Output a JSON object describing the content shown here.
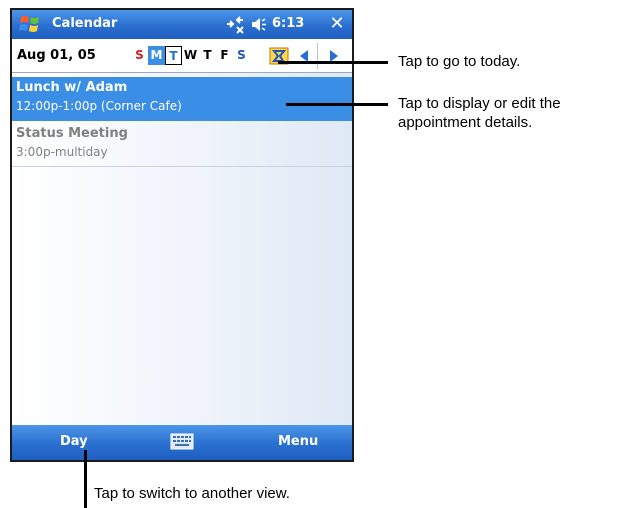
{
  "titlebar": {
    "title": "Calendar",
    "time": "6:13",
    "close_label": "✕",
    "accent_color": "#2a6fd0",
    "icons": [
      "windows-start-icon",
      "connectivity-icon",
      "speaker-icon",
      "close-icon"
    ]
  },
  "datebar": {
    "date": "Aug 01, 05",
    "weekdays": [
      "S",
      "M",
      "T",
      "W",
      "T",
      "F",
      "S"
    ],
    "icons": [
      "today-icon",
      "arrow-left-icon",
      "arrow-right-icon"
    ]
  },
  "appointments": [
    {
      "title": "Lunch w/ Adam",
      "detail": "12:00p-1:00p (Corner Cafe)",
      "selected": true
    },
    {
      "title": "Status Meeting",
      "detail": "3:00p-multiday",
      "selected": false
    }
  ],
  "menubar": {
    "left_label": "Day",
    "right_label": "Menu",
    "icons": [
      "keyboard-icon"
    ]
  },
  "callouts": {
    "today": "Tap to go to today.",
    "appointment_line1": "Tap to display or edit the",
    "appointment_line2": "appointment details.",
    "view": "Tap to switch to another view."
  }
}
